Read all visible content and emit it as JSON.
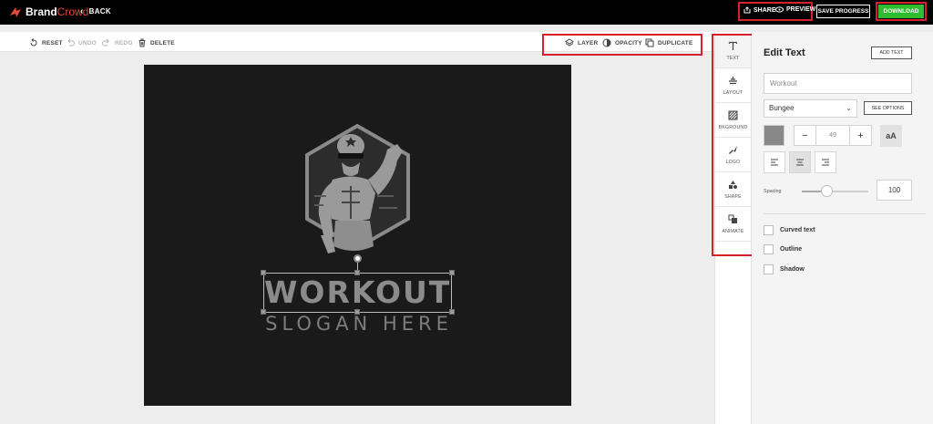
{
  "app": {
    "brand_1": "Brand",
    "brand_2": "Crowd",
    "back_label": "BACK"
  },
  "header": {
    "share_label": "SHARE",
    "preview_label": "PREVIEW",
    "save_label": "SAVE PROGRESS",
    "download_label": "DOWNLOAD"
  },
  "toolbar": {
    "reset": "RESET",
    "undo": "UNDO",
    "redo": "REDO",
    "delete": "DELETE",
    "layer": "LAYER",
    "opacity": "OPACITY",
    "duplicate": "DUPLICATE"
  },
  "canvas": {
    "wordmark": "WORKOUT",
    "slogan": "SLOGAN HERE"
  },
  "tools": [
    {
      "label": "TEXT",
      "icon": "text-icon"
    },
    {
      "label": "LAYOUT",
      "icon": "layout-icon"
    },
    {
      "label": "BKGROUND",
      "icon": "background-icon"
    },
    {
      "label": "LOGO",
      "icon": "logo-icon"
    },
    {
      "label": "SHAPE",
      "icon": "shape-icon"
    },
    {
      "label": "ANIMATE",
      "icon": "animate-icon"
    }
  ],
  "panel": {
    "title": "Edit Text",
    "add_text": "ADD TEXT",
    "text_value": "Workout",
    "font": "Bungee",
    "see_options": "SEE OPTIONS",
    "text_color": "#888888",
    "font_size": "49",
    "case_label": "aA",
    "spacing_label": "Spacing",
    "spacing_value": "100",
    "spacing_slider_fraction": 0.38,
    "curved_text": "Curved text",
    "outline": "Outline",
    "shadow": "Shadow"
  },
  "colors": {
    "accent": "#2fbd2f",
    "highlight": "#d7222e",
    "brand": "#e44a3a"
  }
}
